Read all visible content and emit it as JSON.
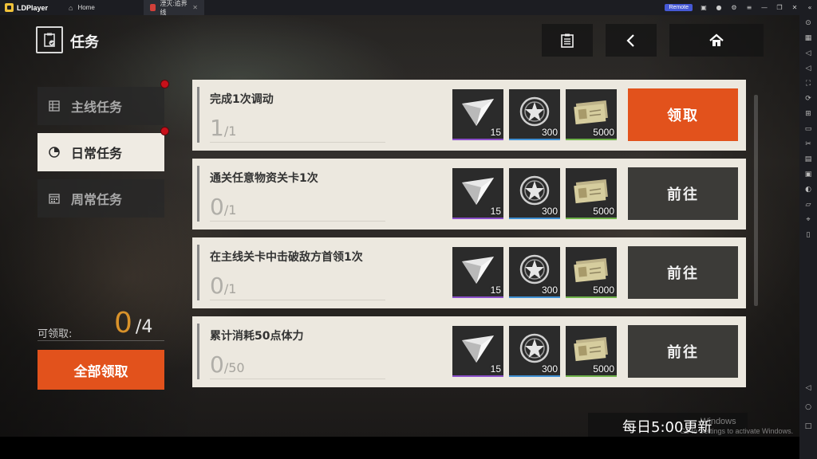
{
  "titlebar": {
    "app_name": "LDPlayer",
    "tabs": [
      {
        "label": "Home",
        "icon": "home-icon"
      },
      {
        "label": "湮灭:追界线",
        "icon": "game-icon"
      }
    ],
    "remote_label": "Remote"
  },
  "header": {
    "title": "任务",
    "icon": "clipboard-check-icon"
  },
  "top_buttons": [
    {
      "icon": "clipboard-list-icon"
    },
    {
      "icon": "back-arrow-icon"
    },
    {
      "icon": "home-icon"
    }
  ],
  "categories": [
    {
      "label": "主线任务",
      "icon": "list-grid-icon",
      "active": false,
      "has_notification": true
    },
    {
      "label": "日常任务",
      "icon": "clock-icon",
      "active": true,
      "has_notification": true
    },
    {
      "label": "周常任务",
      "icon": "calendar-icon",
      "active": false,
      "has_notification": false
    }
  ],
  "claimable": {
    "label": "可领取:",
    "current": "0",
    "total": "/4",
    "claim_all_label": "全部领取"
  },
  "tasks": [
    {
      "title": "完成1次调动",
      "current": "1",
      "total": "/1",
      "button": "领取",
      "button_type": "claim",
      "rewards": [
        {
          "icon": "crystal-icon",
          "qty": "15"
        },
        {
          "icon": "star-medal-icon",
          "qty": "300"
        },
        {
          "icon": "banknote-icon",
          "qty": "5000"
        }
      ]
    },
    {
      "title": "通关任意物资关卡1次",
      "current": "0",
      "total": "/1",
      "button": "前往",
      "button_type": "go",
      "rewards": [
        {
          "icon": "crystal-icon",
          "qty": "15"
        },
        {
          "icon": "star-medal-icon",
          "qty": "300"
        },
        {
          "icon": "banknote-icon",
          "qty": "5000"
        }
      ]
    },
    {
      "title": "在主线关卡中击破敌方首领1次",
      "current": "0",
      "total": "/1",
      "button": "前往",
      "button_type": "go",
      "rewards": [
        {
          "icon": "crystal-icon",
          "qty": "15"
        },
        {
          "icon": "star-medal-icon",
          "qty": "300"
        },
        {
          "icon": "banknote-icon",
          "qty": "5000"
        }
      ]
    },
    {
      "title": "累计消耗50点体力",
      "current": "0",
      "total": "/50",
      "button": "前往",
      "button_type": "go",
      "rewards": [
        {
          "icon": "crystal-icon",
          "qty": "15"
        },
        {
          "icon": "star-medal-icon",
          "qty": "300"
        },
        {
          "icon": "banknote-icon",
          "qty": "5000"
        }
      ]
    }
  ],
  "reset_text": "每日5:00更新",
  "watermark": {
    "line1": "Windows",
    "line2": "Go to Settings to activate Windows."
  },
  "colors": {
    "accent_orange": "#e2521c",
    "count_gold": "#d9922a",
    "notification_red": "#c8101a",
    "rarity_purple": "#8a4fc9",
    "rarity_blue": "#3f8fd2",
    "rarity_green": "#6fb24a"
  }
}
